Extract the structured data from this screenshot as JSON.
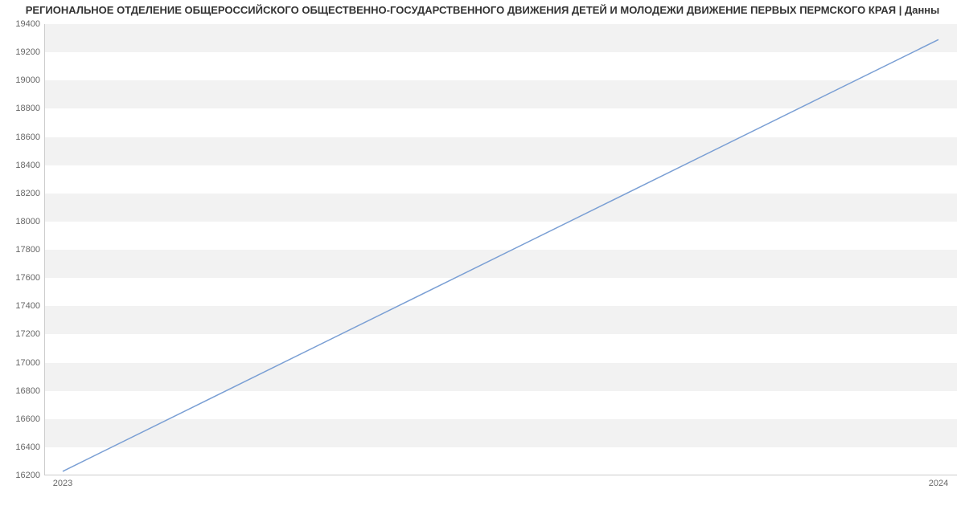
{
  "chart_data": {
    "type": "line",
    "title": "РЕГИОНАЛЬНОЕ ОТДЕЛЕНИЕ ОБЩЕРОССИЙСКОГО ОБЩЕСТВЕННО-ГОСУДАРСТВЕННОГО ДВИЖЕНИЯ ДЕТЕЙ И МОЛОДЕЖИ ДВИЖЕНИЕ ПЕРВЫХ ПЕРМСКОГО КРАЯ | Данны",
    "xlabel": "",
    "ylabel": "",
    "x": [
      "2023",
      "2024"
    ],
    "series": [
      {
        "name": "",
        "color": "#7a9fd4",
        "values": [
          16229,
          19290
        ]
      }
    ],
    "y_ticks": [
      16200,
      16400,
      16600,
      16800,
      17000,
      17200,
      17400,
      17600,
      17800,
      18000,
      18200,
      18400,
      18600,
      18800,
      19000,
      19200,
      19400
    ],
    "ylim": [
      16200,
      19400
    ],
    "x_tick_labels": [
      "2023",
      "2024"
    ],
    "grid": true
  }
}
